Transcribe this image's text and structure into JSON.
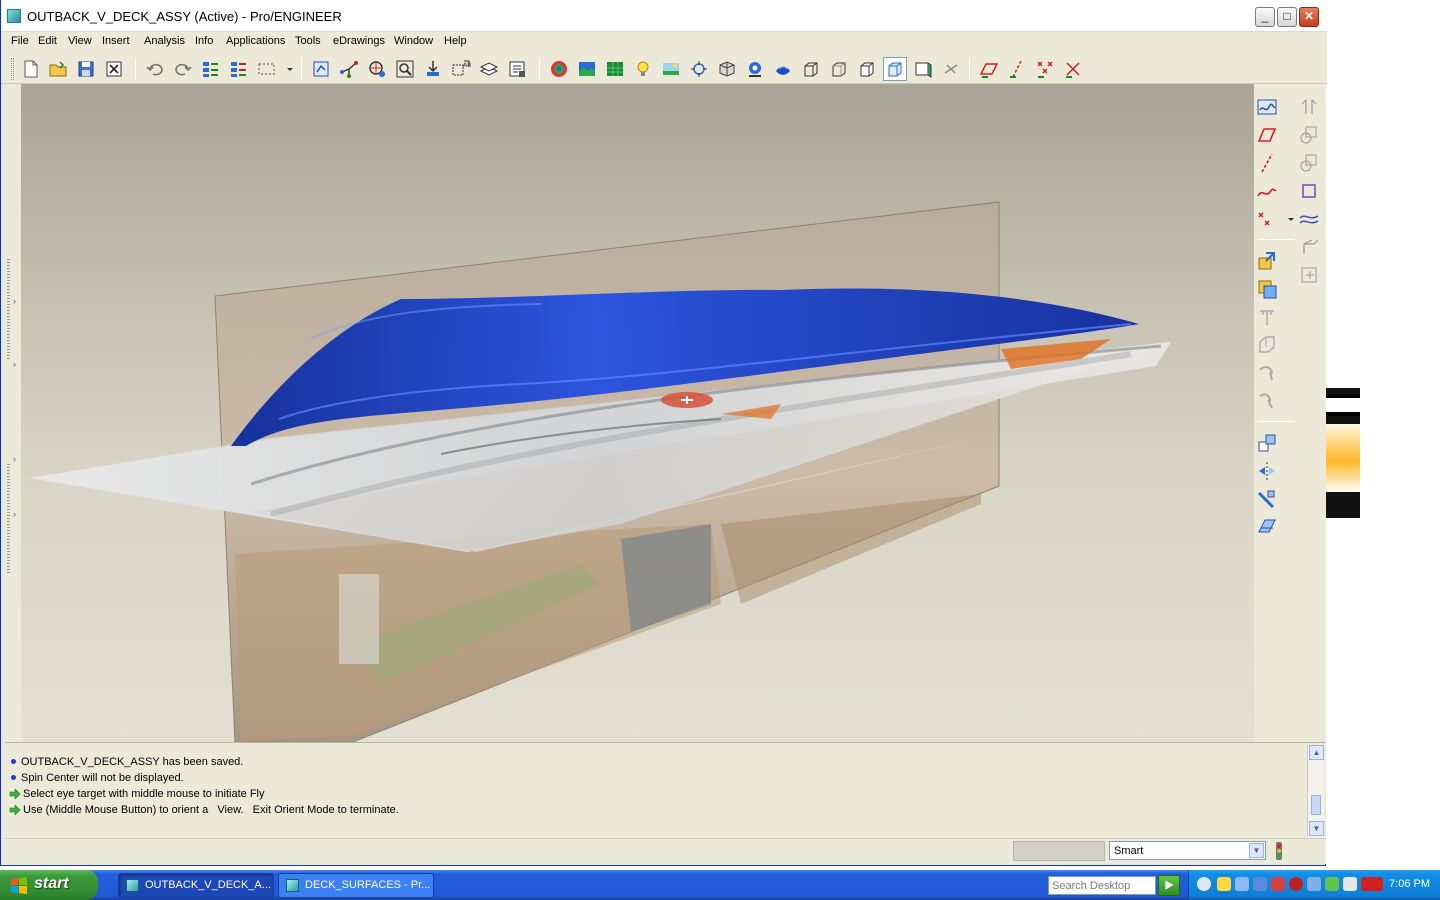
{
  "window": {
    "title": "OUTBACK_V_DECK_ASSY (Active) - Pro/ENGINEER",
    "minimize": "_",
    "maximize": "□",
    "close": "✕"
  },
  "menu": [
    "File",
    "Edit",
    "View",
    "Insert",
    "Analysis",
    "Info",
    "Applications",
    "Tools",
    "eDrawings",
    "Window",
    "Help"
  ],
  "toolbar_icons": [
    "new-file-icon",
    "open-file-icon",
    "save-icon",
    "close-window-icon",
    "undo-icon",
    "redo-icon",
    "regenerate-icon",
    "regenerate-manager-icon",
    "selection-box-icon",
    "repaint-icon",
    "spin-center-icon",
    "orient-mode-icon",
    "zoom-fit-icon",
    "zoom-in-icon",
    "refit-icon",
    "layers-icon",
    "model-tree-icon",
    "appearance-icon",
    "render-icon",
    "texture-icon",
    "lights-icon",
    "scene-icon",
    "perspective-icon",
    "saved-views-icon",
    "view-manager-icon",
    "shaded-icon",
    "wireframe-icon",
    "hidden-line-icon",
    "no-hidden-icon",
    "shading-icon",
    "shading-edges-icon",
    "hide-datum-icon",
    "datum-planes-icon",
    "datum-axes-icon",
    "datum-points-icon",
    "csys-icon"
  ],
  "right_toolbar_left": [
    "sketched-curve-icon",
    "datum-plane-icon",
    "datum-axis-icon",
    "datum-curve-icon",
    "datum-point-icon",
    "assemble-icon",
    "create-component-icon",
    "hole-icon",
    "round-icon",
    "draft-icon",
    "chamfer-icon",
    "copy-icon",
    "mirror-icon",
    "merge-icon",
    "trim-icon"
  ],
  "right_toolbar_right": [
    "sketch-mirror-icon",
    "boundary-blend-icon",
    "variable-section-icon",
    "style-icon",
    "offset-surface-icon",
    "extend-icon",
    "fill-icon"
  ],
  "messages": [
    {
      "type": "bullet",
      "text": "OUTBACK_V_DECK_ASSY has been saved."
    },
    {
      "type": "bullet",
      "text": "Spin Center will not be displayed."
    },
    {
      "type": "arrow",
      "text": "Select eye target with middle mouse to initiate Fly"
    },
    {
      "type": "arrow",
      "text": "Use (Middle Mouse Button) to orient a   View.   Exit Orient Mode to terminate."
    }
  ],
  "status": {
    "filter_value": "Smart"
  },
  "taskbar": {
    "start_label": "start",
    "tasks": [
      {
        "label": "OUTBACK_V_DECK_A...",
        "active": true
      },
      {
        "label": "DECK_SURFACES - Pr...",
        "active": false
      }
    ],
    "search_placeholder": "Search Desktop",
    "clock": "7:06 PM"
  },
  "colors": {
    "titlebar": "#ffffff",
    "chrome": "#ece9d8",
    "viewport_top": "#a9a497",
    "viewport_bottom": "#e2dfd3",
    "surface_blue": "#1a3fc4",
    "taskbar": "#245edb",
    "start_green": "#3c9b3c"
  }
}
